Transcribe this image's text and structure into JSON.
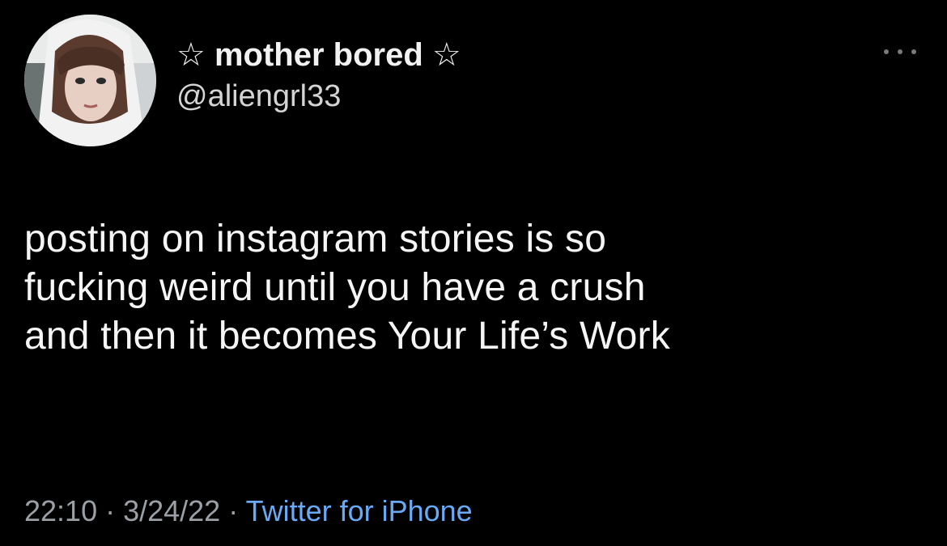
{
  "author": {
    "display_name": "☆ mother bored ☆",
    "handle": "@aliengrl33",
    "avatar_icon": "profile-photo"
  },
  "more_icon": "more-options-icon",
  "tweet": {
    "text": "posting on instagram stories is so\nfucking weird until you have a crush\nand then it becomes Your Life’s Work"
  },
  "meta": {
    "time": "22:10",
    "sep1": " · ",
    "date": "3/24/22",
    "sep2": " · ",
    "source": "Twitter for iPhone"
  },
  "colors": {
    "background": "#000000",
    "source_link": "#6aa9f4",
    "meta_text": "#9aa0a6"
  }
}
